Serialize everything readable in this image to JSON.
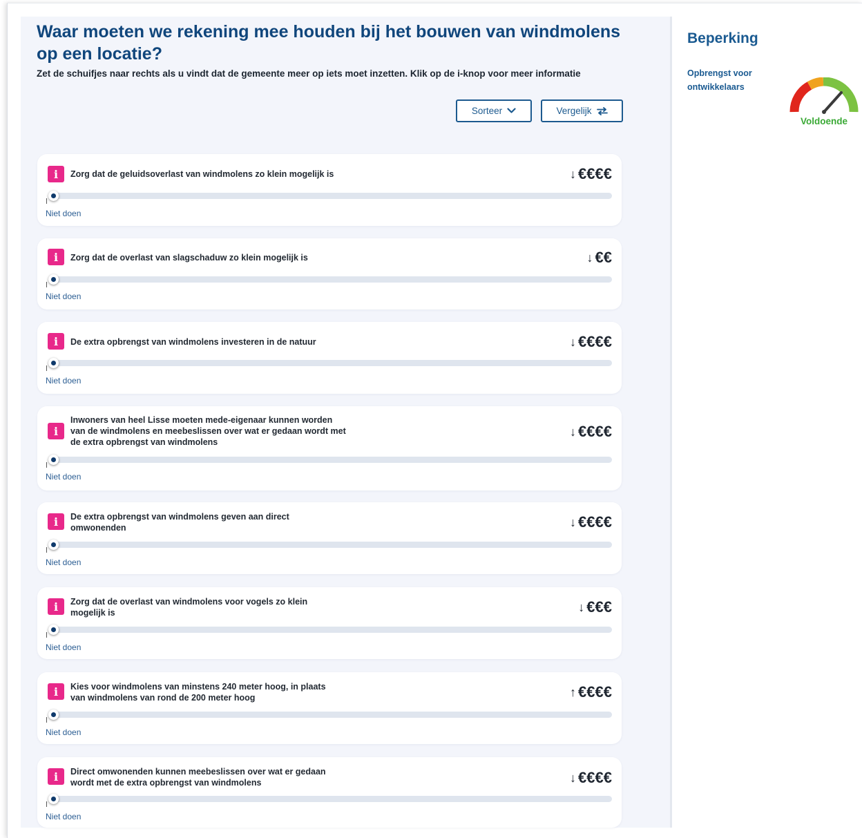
{
  "header": {
    "title": "Waar moeten we rekening mee houden bij het bouwen van windmolens op een locatie?",
    "subtitle": "Zet de schuifjes naar rechts als u vindt dat de gemeente meer op iets moet inzetten. Klik op de i-knop voor meer informatie"
  },
  "toolbar": {
    "sort_label": "Sorteer",
    "compare_label": "Vergelijk"
  },
  "items": [
    {
      "label": "Zorg dat de geluidsoverlast van windmolens zo klein mogelijk is",
      "direction": "↓",
      "cost": "€€€€",
      "level_label": "Niet doen",
      "slider_value": 0
    },
    {
      "label": "Zorg dat de overlast van slagschaduw zo klein mogelijk is",
      "direction": "↓",
      "cost": "€€",
      "level_label": "Niet doen",
      "slider_value": 0
    },
    {
      "label": "De extra opbrengst van windmolens investeren in de natuur",
      "direction": "↓",
      "cost": "€€€€",
      "level_label": "Niet doen",
      "slider_value": 0
    },
    {
      "label": "Inwoners van heel Lisse moeten mede-eigenaar kunnen worden van de windmolens en meebeslissen over wat er gedaan wordt met de extra opbrengst van windmolens",
      "direction": "↓",
      "cost": "€€€€",
      "level_label": "Niet doen",
      "slider_value": 0
    },
    {
      "label": "De extra opbrengst van windmolens geven aan direct omwonenden",
      "direction": "↓",
      "cost": "€€€€",
      "level_label": "Niet doen",
      "slider_value": 0
    },
    {
      "label": "Zorg dat de overlast van windmolens voor vogels zo klein mogelijk is",
      "direction": "↓",
      "cost": "€€€",
      "level_label": "Niet doen",
      "slider_value": 0
    },
    {
      "label": "Kies voor windmolens van minstens 240 meter hoog, in plaats van windmolens van rond de 200 meter hoog",
      "direction": "↑",
      "cost": "€€€€",
      "level_label": "Niet doen",
      "slider_value": 0
    },
    {
      "label": "Direct omwonenden kunnen meebeslissen over wat er gedaan wordt met de extra opbrengst van windmolens",
      "direction": "↓",
      "cost": "€€€€",
      "level_label": "Niet doen",
      "slider_value": 0
    }
  ],
  "sidebar": {
    "title": "Beperking",
    "constraint_label": "Opbrengst voor ontwikkelaars",
    "gauge_status": "Voldoende",
    "gauge_colors": {
      "red": "#e0261c",
      "orange": "#f0a21e",
      "green": "#7cc242",
      "needle": "#3a3a3a",
      "status_text": "#3aa935"
    }
  },
  "icons": {
    "info": "info-icon",
    "sort": "chevron-down-icon",
    "compare": "swap-arrows-icon"
  }
}
